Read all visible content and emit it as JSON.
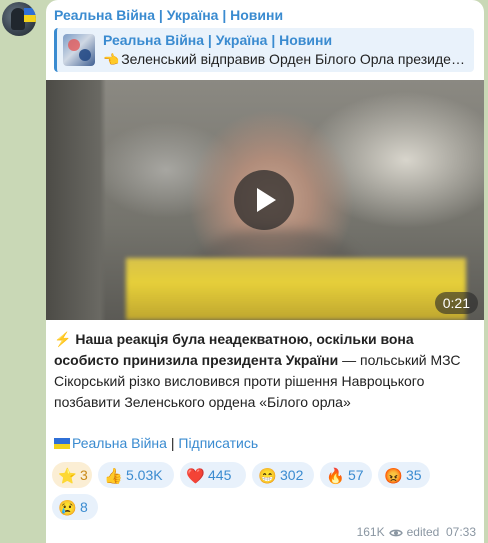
{
  "colors": {
    "accent": "#3a8bd0",
    "background": "#c9d8b6",
    "bubble": "#ffffff",
    "paid_star": "#c98a1a"
  },
  "post": {
    "channel_name": "Реальна Війна | Україна | Новини",
    "reply": {
      "title": "Реальна Війна | Україна | Новини",
      "text": "Зеленський відправив Орден Білого Орла президе…"
    },
    "video": {
      "duration": "0:21",
      "play_icon": "play-icon"
    },
    "caption": {
      "bold": "Наша реакція була неадекватною, оскільки вона особисто принизила президента України",
      "rest": " — польський МЗС Сікорський різко висловився проти рішення Навроцького позбавити Зеленського ордена «Білого орла»"
    },
    "footer": {
      "channel_link": "Реальна Війна",
      "separator": " | ",
      "subscribe": "Підписатись"
    },
    "reactions": [
      {
        "emoji": "⭐",
        "count": "3",
        "type": "paid-star"
      },
      {
        "emoji": "👍",
        "count": "5.03K",
        "type": "thumbs-up"
      },
      {
        "emoji": "❤️",
        "count": "445",
        "type": "heart"
      },
      {
        "emoji": "😁",
        "count": "302",
        "type": "grin"
      },
      {
        "emoji": "🔥",
        "count": "57",
        "type": "fire"
      },
      {
        "emoji": "😡",
        "count": "35",
        "type": "angry"
      },
      {
        "emoji": "😢",
        "count": "8",
        "type": "cry"
      }
    ],
    "meta": {
      "views": "161K",
      "edited": "edited",
      "time": "07:33"
    }
  }
}
